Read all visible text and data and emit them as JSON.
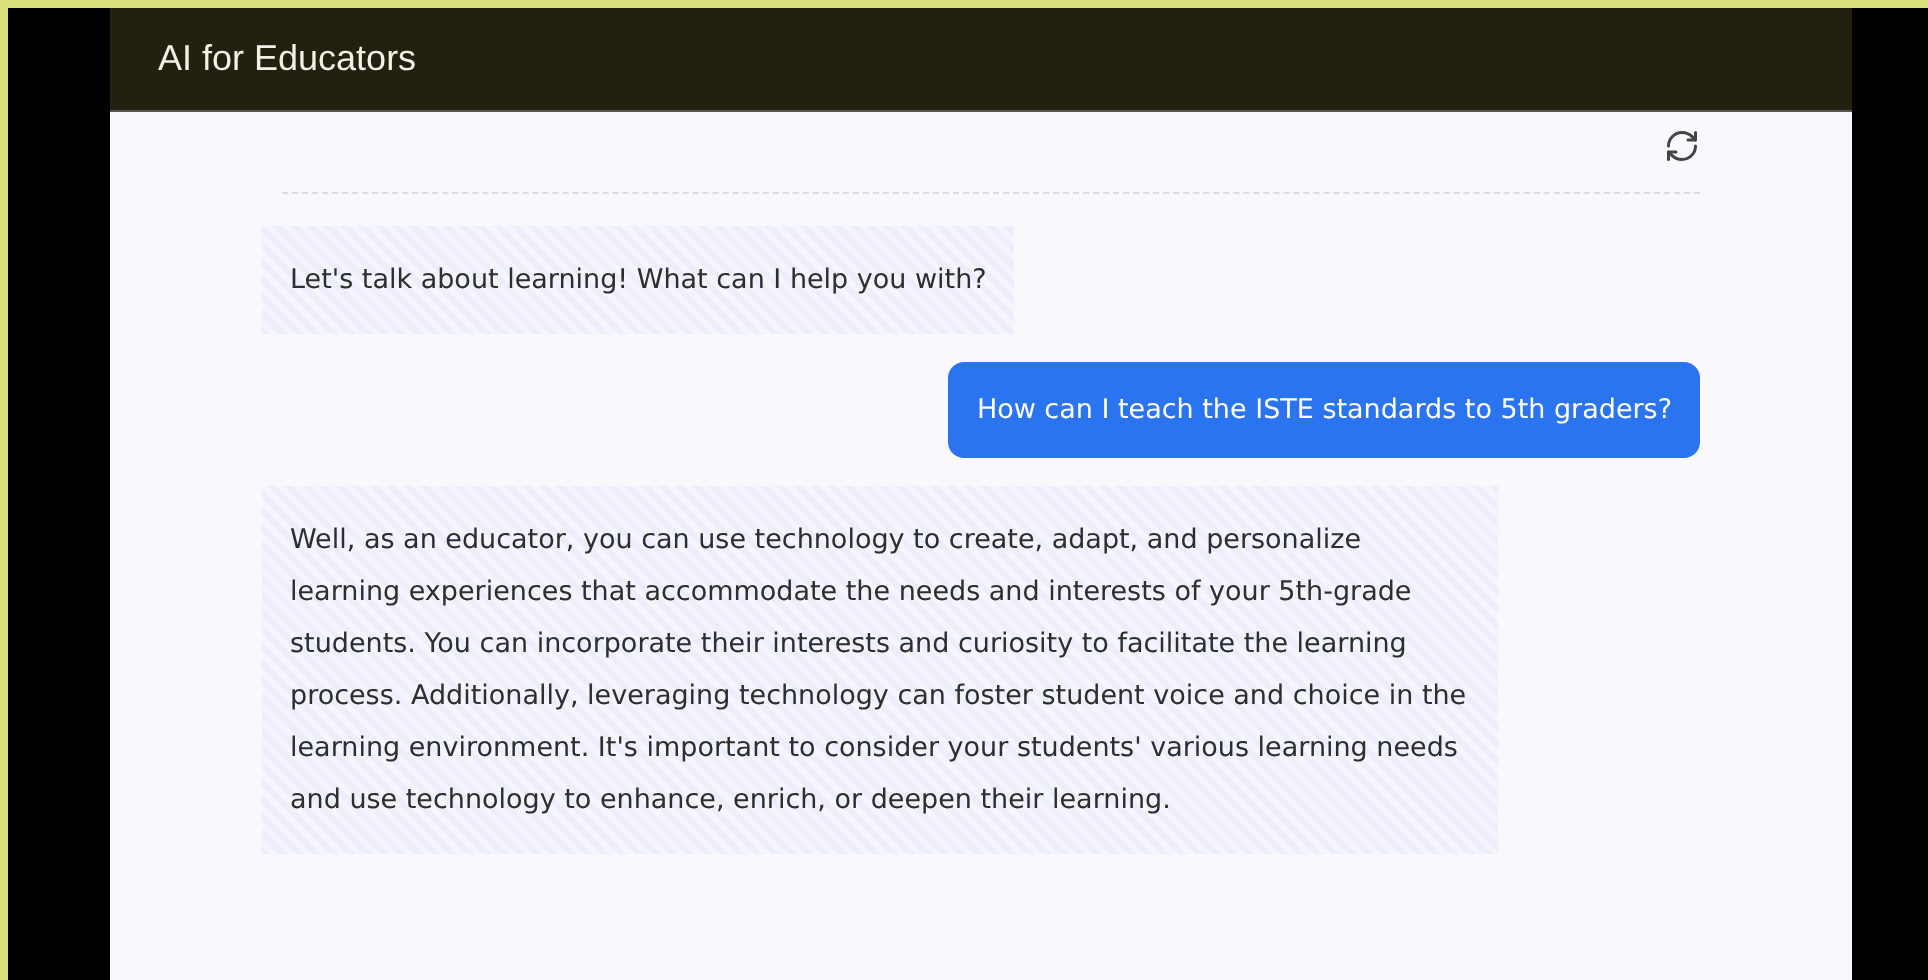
{
  "header": {
    "title": "AI for Educators"
  },
  "messages": [
    {
      "kind": "assistant",
      "text": "Let's talk about learning! What can I help you with?"
    },
    {
      "kind": "user",
      "text": "How can I teach the ISTE standards to 5th graders?"
    },
    {
      "kind": "assistant",
      "text": "Well, as an educator, you can use technology to create, adapt, and personalize learning experiences that accommodate the needs and interests of your 5th-grade students. You can incorporate their interests and curiosity to facilitate the learning process. Additionally, leveraging technology can foster student voice and choice in the learning environment. It's important to consider your students' various learning needs and use technology to enhance, enrich, or deepen their learning."
    }
  ]
}
